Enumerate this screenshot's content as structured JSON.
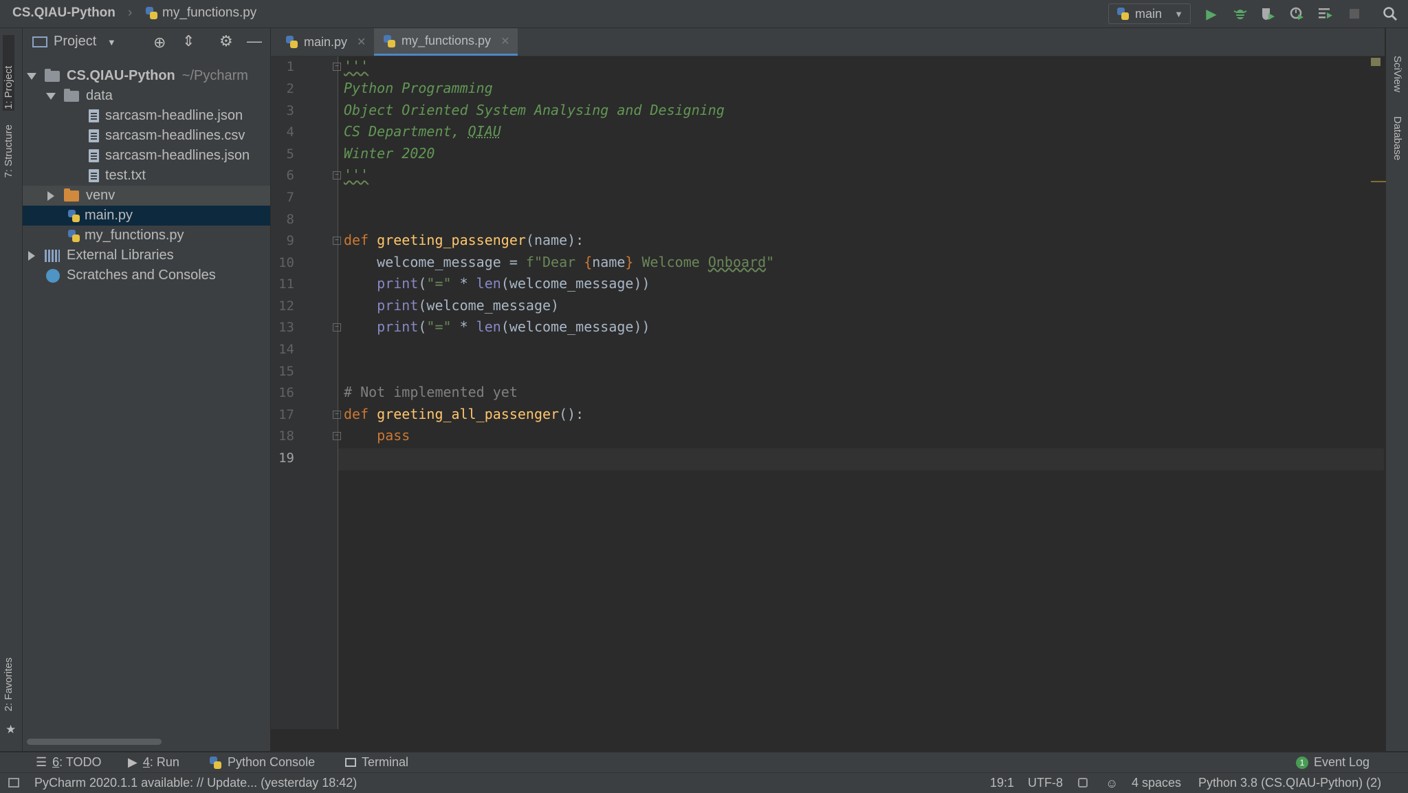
{
  "titlebar": {
    "project": "CS.QIAU-Python",
    "file": "my_functions.py",
    "run_config": "main"
  },
  "left_tabs": [
    "1: Project",
    "7: Structure",
    "2: Favorites"
  ],
  "right_tabs": [
    "SciView",
    "Database"
  ],
  "project_panel": {
    "title": "Project",
    "root": "CS.QIAU-Python",
    "root_path": "~/Pycharm",
    "data_folder": "data",
    "data_files": [
      "sarcasm-headline.json",
      "sarcasm-headlines.csv",
      "sarcasm-headlines.json",
      "test.txt"
    ],
    "venv": "venv",
    "main_file": "main.py",
    "functions_file": "my_functions.py",
    "external": "External Libraries",
    "scratches": "Scratches and Consoles"
  },
  "tabs": [
    {
      "label": "main.py",
      "active": false
    },
    {
      "label": "my_functions.py",
      "active": true
    }
  ],
  "editor": {
    "current_line": 19,
    "lines": {
      "l1": "'''",
      "l2": "Python Programming",
      "l3": "Object Oriented System Analysing and Designing",
      "l4a": "CS Department, ",
      "l4b": "QIAU",
      "l5": "Winter 2020",
      "l6": "'''",
      "l9_kw": "def",
      "l9_fn": "greeting_passenger",
      "l9_rest": "(name):",
      "l10_var": "    welcome_message = ",
      "l10_s1": "f\"Dear ",
      "l10_brace1": "{",
      "l10_name": "name",
      "l10_brace2": "}",
      "l10_s2": " Welcome ",
      "l10_onboard": "Onboard",
      "l10_s3": "\"",
      "l11_bi": "    print",
      "l11_a": "(",
      "l11_s": "\"=\"",
      "l11_b": " * ",
      "l11_len": "len",
      "l11_c": "(welcome_message))",
      "l12_bi": "    print",
      "l12_c": "(welcome_message)",
      "l13_bi": "    print",
      "l13_a": "(",
      "l13_s": "\"=\"",
      "l13_b": " * ",
      "l13_len": "len",
      "l13_c": "(welcome_message))",
      "l16": "# Not implemented yet",
      "l17_kw": "def",
      "l17_fn": "greeting_all_passenger",
      "l17_rest": "():",
      "l18": "    pass"
    }
  },
  "tool_tabs": {
    "todo_num": "6",
    "todo": ": TODO",
    "run_num": "4",
    "run": ": Run",
    "console": "Python Console",
    "terminal": "Terminal",
    "event_log": "Event Log",
    "event_count": "1"
  },
  "status": {
    "message": "PyCharm 2020.1.1 available: // Update... (yesterday 18:42)",
    "position": "19:1",
    "encoding": "UTF-8",
    "indent": "4 spaces",
    "interpreter": "Python 3.8 (CS.QIAU-Python) (2)"
  },
  "icons": {
    "run": "run-icon",
    "debug": "debug-icon",
    "coverage": "coverage-icon",
    "profile": "profile-icon",
    "search": "search-icon"
  },
  "colors": {
    "background": "#2b2b2b",
    "panel": "#3c3f41",
    "selection": "#0d293e",
    "keyword": "#cc7832",
    "function": "#ffc66d",
    "string": "#6a8759",
    "docstring": "#629755"
  }
}
